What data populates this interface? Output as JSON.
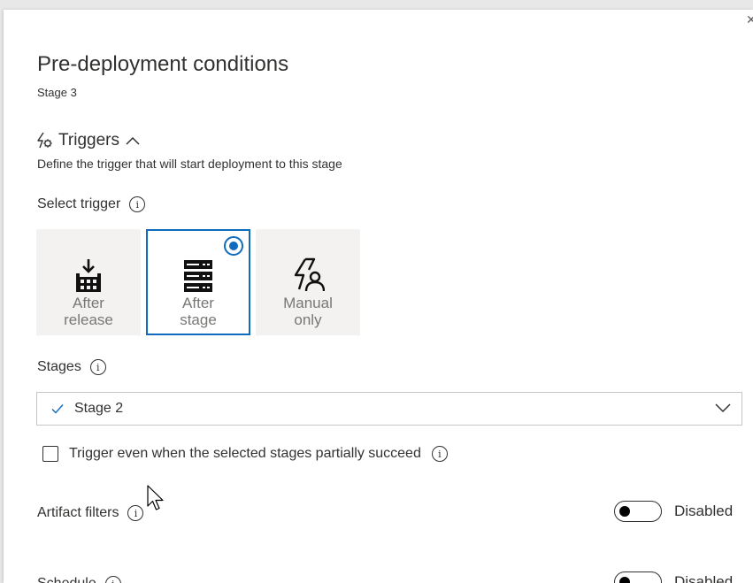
{
  "panel": {
    "close_icon": "close-icon",
    "title": "Pre-deployment conditions",
    "subtitle": "Stage 3"
  },
  "triggers": {
    "heading": "Triggers",
    "description": "Define the trigger that will start deployment to this stage",
    "select_label": "Select trigger",
    "options": [
      {
        "line1": "After",
        "line2": "release",
        "icon": "release-icon",
        "selected": false
      },
      {
        "line1": "After",
        "line2": "stage",
        "icon": "stage-icon",
        "selected": true
      },
      {
        "line1": "Manual",
        "line2": "only",
        "icon": "manual-icon",
        "selected": false
      }
    ]
  },
  "stages": {
    "label": "Stages",
    "selected_value": "Stage 2",
    "partial_succeed_label": "Trigger even when the selected stages partially succeed",
    "partial_succeed_checked": false
  },
  "artifact_filters": {
    "label": "Artifact filters",
    "state": "Disabled"
  },
  "schedule": {
    "label": "Schedule",
    "state": "Disabled"
  },
  "colors": {
    "accent": "#0f6cbd",
    "tile_bg": "#f3f2f1",
    "text": "#323130",
    "muted": "#797775"
  }
}
